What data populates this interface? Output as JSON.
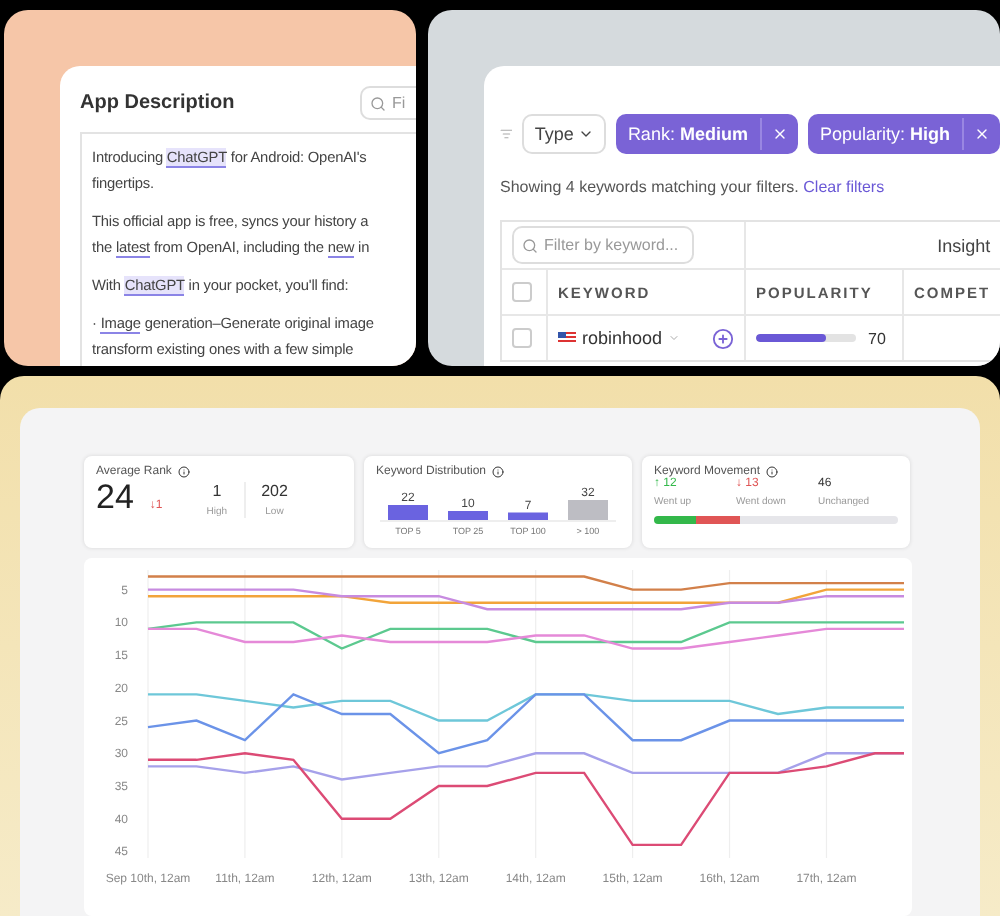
{
  "app_description_panel": {
    "title": "App Description",
    "search": {
      "placeholder": "Fi"
    },
    "paragraphs": [
      [
        [
          {
            "kind": "plain",
            "text": "Introducing "
          },
          {
            "kind": "highlight",
            "text": "ChatGPT"
          },
          {
            "kind": "plain",
            "text": " for Android: OpenAI's"
          }
        ],
        [
          {
            "kind": "plain",
            "text": "fingertips."
          }
        ]
      ],
      [
        [
          {
            "kind": "plain",
            "text": "This official app is free, syncs your history a"
          }
        ],
        [
          {
            "kind": "plain",
            "text": "the "
          },
          {
            "kind": "underline",
            "text": "latest"
          },
          {
            "kind": "plain",
            "text": " from OpenAI, including the "
          },
          {
            "kind": "underline",
            "text": "new"
          },
          {
            "kind": "plain",
            "text": " in"
          }
        ]
      ],
      [
        [
          {
            "kind": "plain",
            "text": "With "
          },
          {
            "kind": "highlight",
            "text": "ChatGPT"
          },
          {
            "kind": "plain",
            "text": " in your pocket, you'll find:"
          }
        ]
      ],
      [
        [
          {
            "kind": "plain",
            "text": "· "
          },
          {
            "kind": "underline",
            "text": "Image"
          },
          {
            "kind": "plain",
            "text": " generation–Generate original image"
          }
        ],
        [
          {
            "kind": "plain",
            "text": "transform existing ones with a few simple"
          }
        ]
      ]
    ]
  },
  "keywords_panel": {
    "type_dropdown": "Type",
    "filters": [
      {
        "label": "Rank: **Medium**"
      },
      {
        "label": "Popularity: **High**"
      }
    ],
    "summary": "Showing 4 keywords matching your filters.",
    "clear_link": "Clear filters",
    "table": {
      "search": {
        "placeholder": "Filter by keyword..."
      },
      "group_heading": "Insight",
      "header_checked": false,
      "columns": [
        "KEYWORD",
        "POPULARITY",
        "COMPET"
      ],
      "rows": [
        {
          "checked": false,
          "keyword": "robinhood",
          "popularity": {
            "level": 0.7,
            "value": "70"
          }
        }
      ]
    }
  },
  "rank_dashboard": {
    "average_rank": {
      "title": "Average Rank",
      "value": "24",
      "change": "↓1",
      "high": "1",
      "high_label": "High",
      "low": "202",
      "low_label": "Low"
    },
    "distribution": {
      "title": "Keyword Distribution",
      "chart_data": {
        "type": "bar",
        "categories": [
          "TOP 5",
          "TOP 25",
          "TOP 100",
          "> 100"
        ],
        "series": [
          {
            "color": "#6a63e0",
            "values": [
              22,
              10,
              7,
              null
            ]
          },
          {
            "color": "#bdbdc3",
            "values": [
              null,
              null,
              null,
              32
            ]
          }
        ],
        "data_labels": true
      }
    },
    "movement": {
      "title": "Keyword Movement",
      "items": [
        {
          "value": "↑ 12",
          "label": "Went up",
          "color": "#33b84a",
          "level": 0.17
        },
        {
          "value": "↓ 13",
          "label": "Went down",
          "color": "#e05555",
          "level": 0.18
        },
        {
          "value": "46",
          "label": "Unchanged",
          "color": "#e6e6ea",
          "level": 0.65
        }
      ]
    },
    "rank_chart": {
      "chart_data": {
        "type": "line",
        "grid": true,
        "ylim": [
          46,
          2
        ],
        "yticks": [
          5,
          10,
          15,
          20,
          25,
          30,
          35,
          40,
          45
        ],
        "categories": [
          "Sep 10th, 12am",
          null,
          "11th, 12am",
          null,
          "12th, 12am",
          null,
          "13th, 12am",
          null,
          "14th, 12am",
          null,
          "15th, 12am",
          null,
          "16th, 12am",
          null,
          "17th, 12am",
          null
        ],
        "series": [
          {
            "color": "#d2804a",
            "values": [
              3,
              3,
              3,
              3,
              3,
              3,
              3,
              3,
              3,
              3,
              5,
              5,
              4,
              4,
              4,
              4
            ]
          },
          {
            "color": "#f2a43a",
            "values": [
              6,
              6,
              6,
              6,
              6,
              7,
              7,
              7,
              7,
              7,
              7,
              7,
              7,
              7,
              5,
              5
            ]
          },
          {
            "color": "#c78be0",
            "values": [
              5,
              5,
              5,
              5,
              6,
              6,
              6,
              8,
              8,
              8,
              8,
              8,
              7,
              7,
              6,
              6
            ]
          },
          {
            "color": "#5cc98f",
            "values": [
              11,
              10,
              10,
              10,
              14,
              11,
              11,
              11,
              13,
              13,
              13,
              13,
              10,
              10,
              10,
              10
            ]
          },
          {
            "color": "#e589d8",
            "values": [
              11,
              11,
              13,
              13,
              12,
              13,
              13,
              13,
              12,
              12,
              14,
              14,
              13,
              12,
              11,
              11
            ]
          },
          {
            "color": "#6ec7d9",
            "values": [
              21,
              21,
              22,
              23,
              22,
              22,
              25,
              25,
              21,
              21,
              22,
              22,
              22,
              24,
              23,
              23
            ]
          },
          {
            "color": "#6b93e8",
            "values": [
              26,
              25,
              28,
              21,
              24,
              24,
              30,
              28,
              21,
              21,
              28,
              28,
              25,
              25,
              25,
              25
            ]
          },
          {
            "color": "#a6a1ea",
            "values": [
              32,
              32,
              33,
              32,
              34,
              33,
              32,
              32,
              30,
              30,
              33,
              33,
              33,
              33,
              30,
              30
            ]
          },
          {
            "color": "#dc4b75",
            "values": [
              31,
              31,
              30,
              31,
              40,
              40,
              35,
              35,
              33,
              33,
              44,
              44,
              33,
              33,
              32,
              30
            ]
          }
        ]
      }
    }
  }
}
